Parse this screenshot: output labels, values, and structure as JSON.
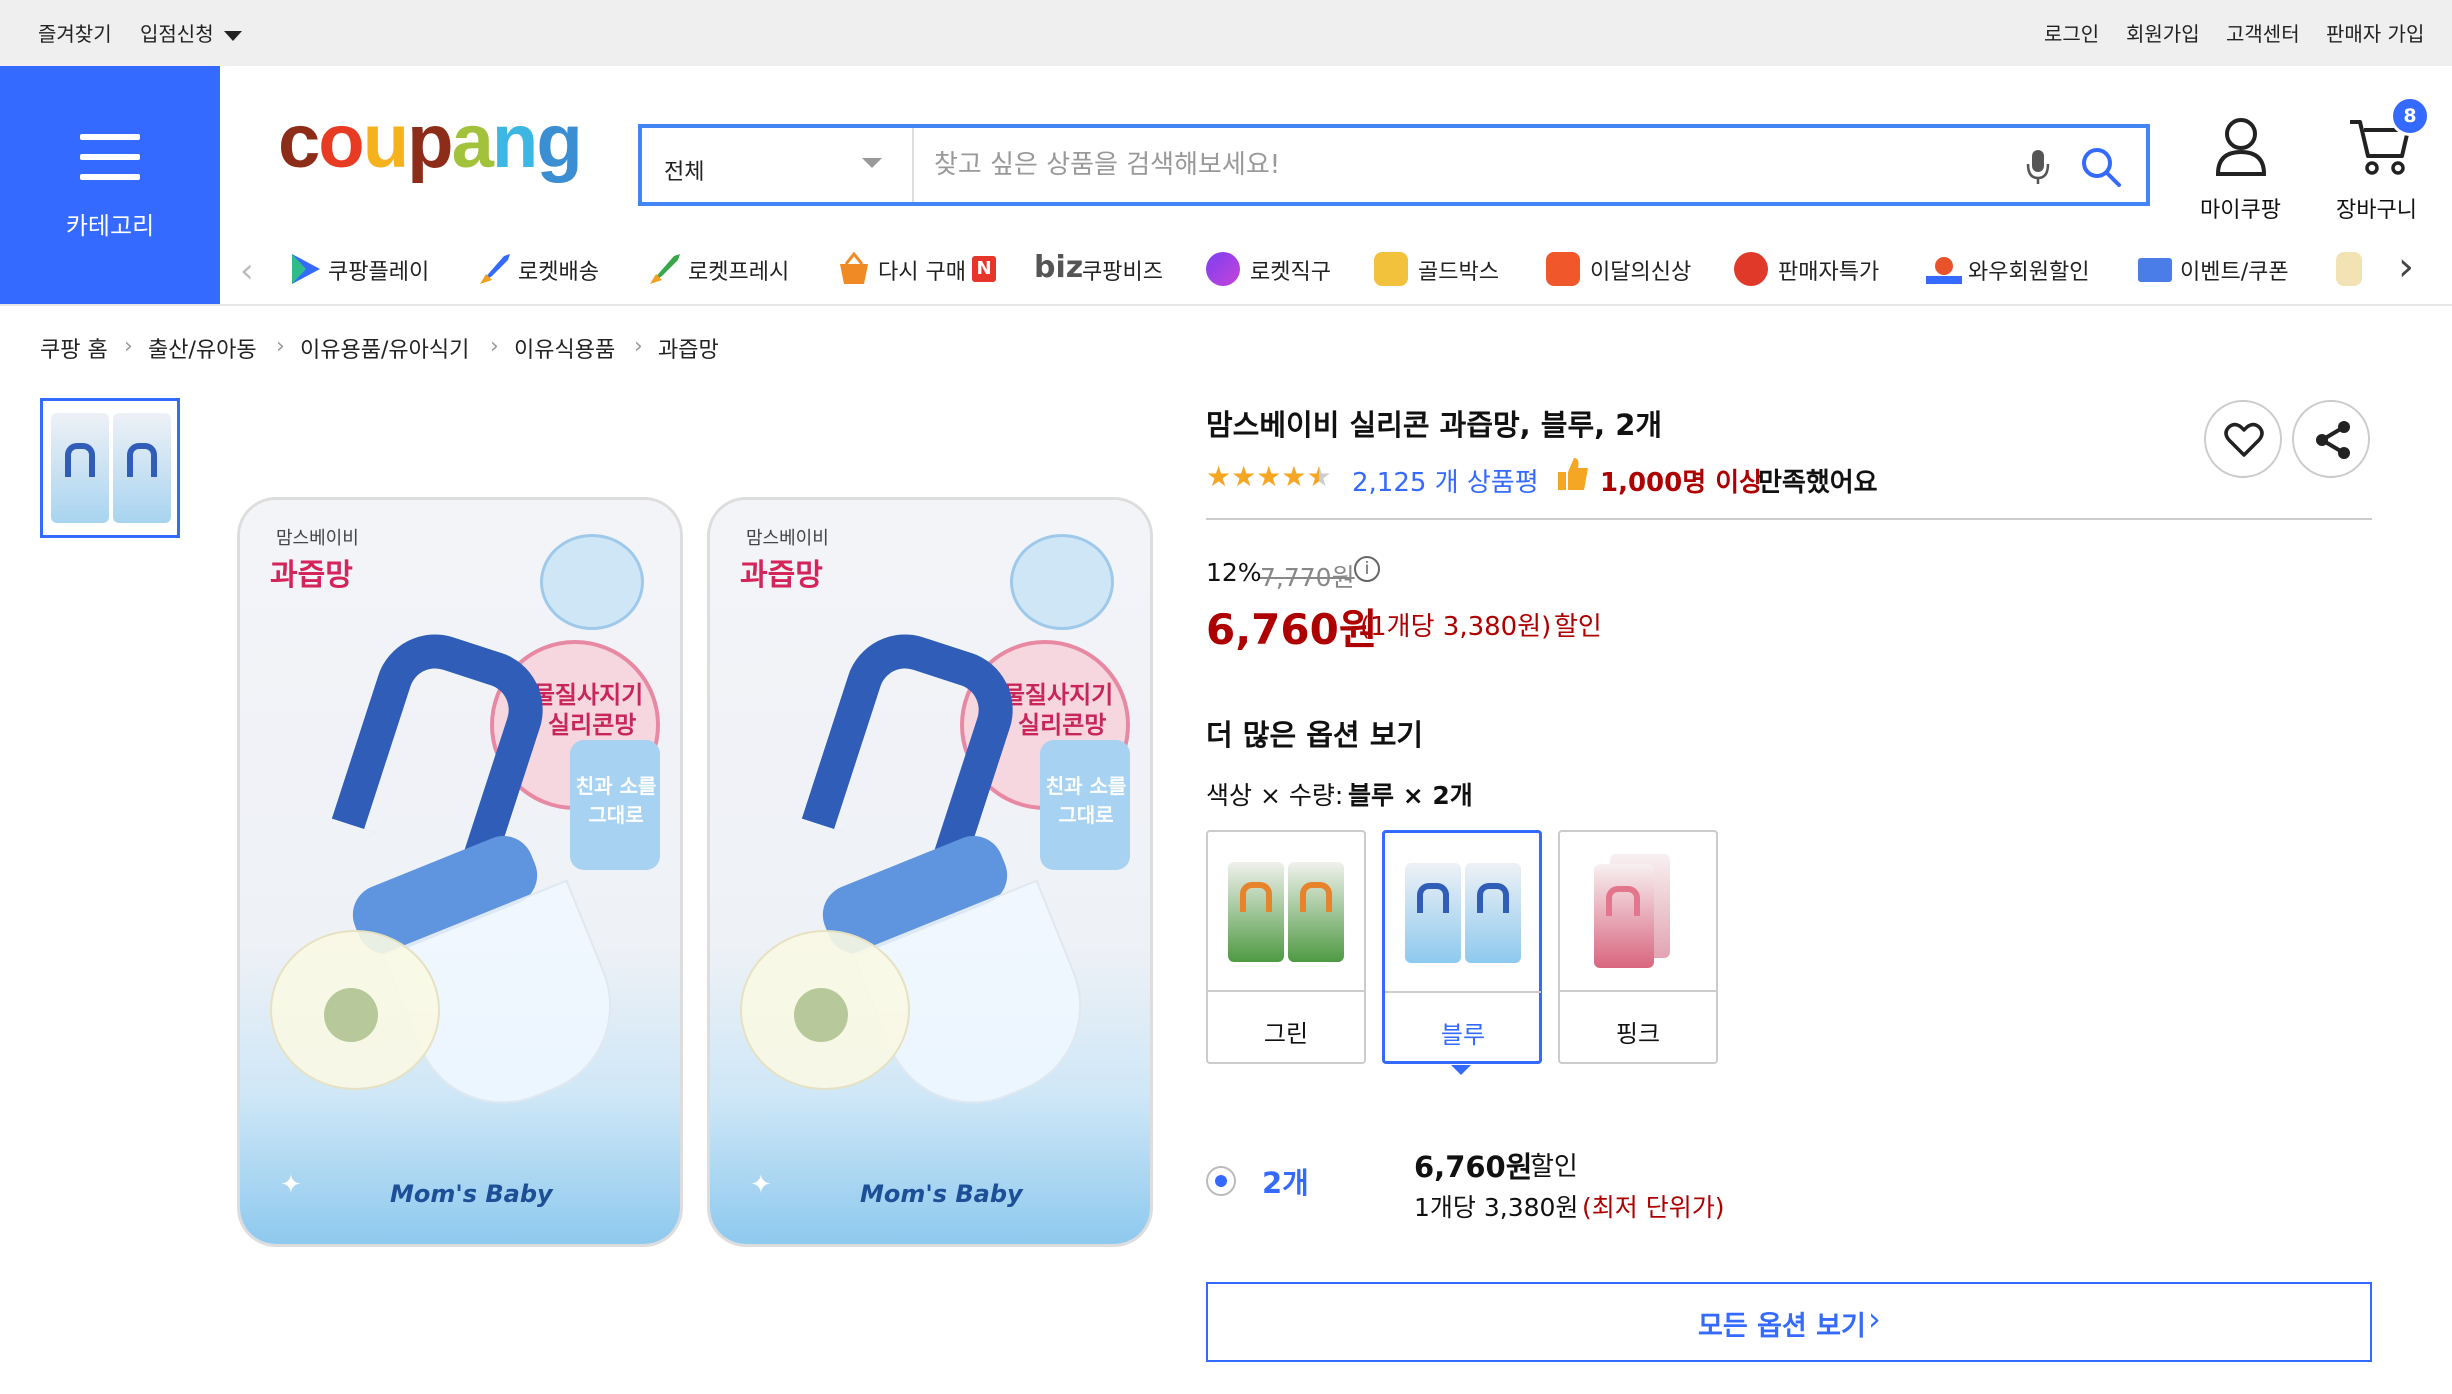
{
  "topbar": {
    "favorites": "즐겨찾기",
    "entry": "입점신청",
    "login": "로그인",
    "signup": "회원가입",
    "support": "고객센터",
    "seller": "판매자 가입"
  },
  "category": {
    "label": "카테고리"
  },
  "logo": {
    "text": "coupang"
  },
  "search": {
    "scope": "전체",
    "placeholder": "찾고 싶은 상품을 검색해보세요!"
  },
  "account": {
    "mycoupang": "마이쿠팡",
    "cart": "장바구니",
    "cart_count": "8"
  },
  "nav": [
    "쿠팡플레이",
    "로켓배송",
    "로켓프레시",
    "다시 구매",
    "쿠팡비즈",
    "로켓직구",
    "골드박스",
    "이달의신상",
    "판매자특가",
    "와우회원할인",
    "이벤트/쿠폰"
  ],
  "nav_extra": {
    "biz": "biz",
    "n_badge": "N"
  },
  "breadcrumb": [
    "쿠팡 홈",
    "출산/유아동",
    "이유용품/유아식기",
    "이유식용품",
    "과즙망"
  ],
  "product": {
    "title": "맘스베이비 실리콘 과즙망, 블루, 2개",
    "rating": 4.5,
    "review_count": "2,125 개 상품평",
    "satisfaction_count": "1,000명 이상",
    "satisfaction_suffix": "만족했어요",
    "discount_rate": "12%",
    "original_price": "7,770원",
    "price": "6,760원",
    "unit_price": "(1개당 3,380원)",
    "discount_label": "할인",
    "more_options": "더 많은 옵션 보기",
    "option_prefix": "색상 × 수량:",
    "option_selected": "블루 × 2개",
    "colors": [
      {
        "label": "그린",
        "accent": "#e7832a",
        "shell": "#5aa34a"
      },
      {
        "label": "블루",
        "accent": "#2f5db8",
        "shell": "#6ea6e0"
      },
      {
        "label": "핑크",
        "accent": "#e3768c",
        "shell": "#f2c2cc"
      }
    ],
    "qty_label": "2개",
    "qty_price": "6,760원",
    "qty_discount": "할인",
    "qty_unit": "1개당 3,380원",
    "qty_lowest": "(최저 단위가)",
    "all_options": "모든 옵션 보기",
    "pack_brand": "맘스베이비",
    "pack_name": "과즙망",
    "pack_bubble1": "이물질사지기능 실리콘망",
    "pack_bubble2": "친과 소를 그대로",
    "pack_footer": "Mom's Baby"
  },
  "colors": {
    "accent": "#346aff",
    "price_red": "#ae0000",
    "link_blue": "#346aff",
    "star": "#f5a623"
  }
}
